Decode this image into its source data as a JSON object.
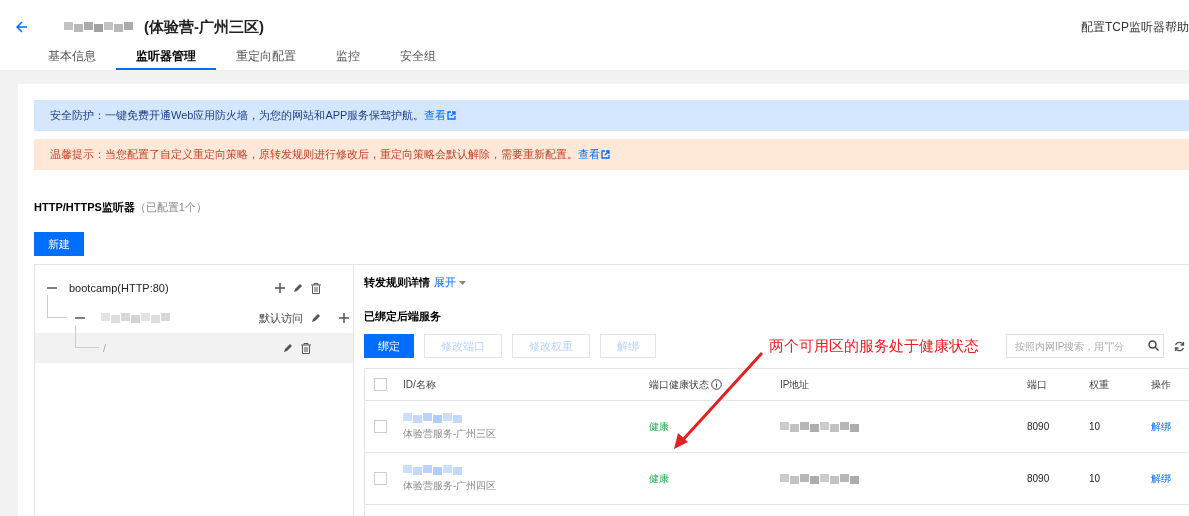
{
  "header": {
    "title": "(体验营-广州三区)",
    "help_link": "配置TCP监听器帮助"
  },
  "tabs": [
    {
      "label": "基本信息",
      "selected": false
    },
    {
      "label": "监听器管理",
      "selected": true
    },
    {
      "label": "重定向配置",
      "selected": false
    },
    {
      "label": "监控",
      "selected": false
    },
    {
      "label": "安全组",
      "selected": false
    }
  ],
  "notices": [
    {
      "kind": "info",
      "text": "安全防护：一键免费开通Web应用防火墙，为您的网站和APP服务保驾护航。",
      "link": "查看"
    },
    {
      "kind": "warning",
      "text": "温馨提示：当您配置了自定义重定向策略，原转发规则进行修改后，重定向策略会默认解除，需要重新配置。",
      "link": "查看"
    }
  ],
  "listener_section": {
    "title": "HTTP/HTTPS监听器",
    "count": "（已配置1个）",
    "new_button": "新建"
  },
  "tree": [
    {
      "kind": "listener",
      "label": "bootcamp(HTTP:80)",
      "expanded": true,
      "children": [
        {
          "kind": "domain",
          "tag": "默认访问",
          "expanded": true,
          "children": [
            {
              "kind": "path",
              "label": "/",
              "selected": true
            }
          ]
        }
      ]
    }
  ],
  "rules": {
    "title": "转发规则详情",
    "toggle": "展开"
  },
  "backend": {
    "title": "已绑定后端服务",
    "buttons": [
      {
        "label": "绑定",
        "disabled": false
      },
      {
        "label": "修改端口",
        "disabled": true
      },
      {
        "label": "修改权重",
        "disabled": true
      },
      {
        "label": "解绑",
        "disabled": true
      }
    ],
    "search": {
      "placeholder": "按照内网IP搜索，用\"|\"分"
    },
    "header_checked": false,
    "columns": [
      "ID/名称",
      "端口健康状态",
      "IP地址",
      "端口",
      "权重",
      "操作"
    ],
    "rows": [
      {
        "checked": false,
        "name": "体验营服务-广州三区",
        "health": "健康",
        "port": "8090",
        "weight": "10",
        "action": "解绑"
      },
      {
        "checked": false,
        "name": "体验营服务-广州四区",
        "health": "健康",
        "port": "8090",
        "weight": "10",
        "action": "解绑"
      }
    ]
  },
  "annotation": {
    "text": "两个可用区的服务处于健康状态"
  }
}
